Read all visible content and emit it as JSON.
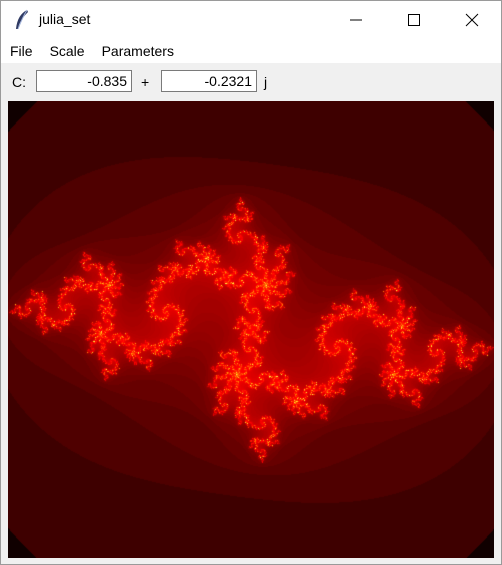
{
  "window": {
    "title": "julia_set"
  },
  "menu": {
    "items": [
      "File",
      "Scale",
      "Parameters"
    ]
  },
  "params": {
    "c_label": "C:",
    "real_value": "-0.835",
    "plus_label": "+",
    "imag_value": "-0.2321",
    "imag_unit": "j"
  },
  "fractal": {
    "c_real": -0.835,
    "c_imag": -0.2321
  },
  "colors": {
    "background": "#100000",
    "accent_red": "#ff0000",
    "accent_yellow": "#ffff00"
  }
}
